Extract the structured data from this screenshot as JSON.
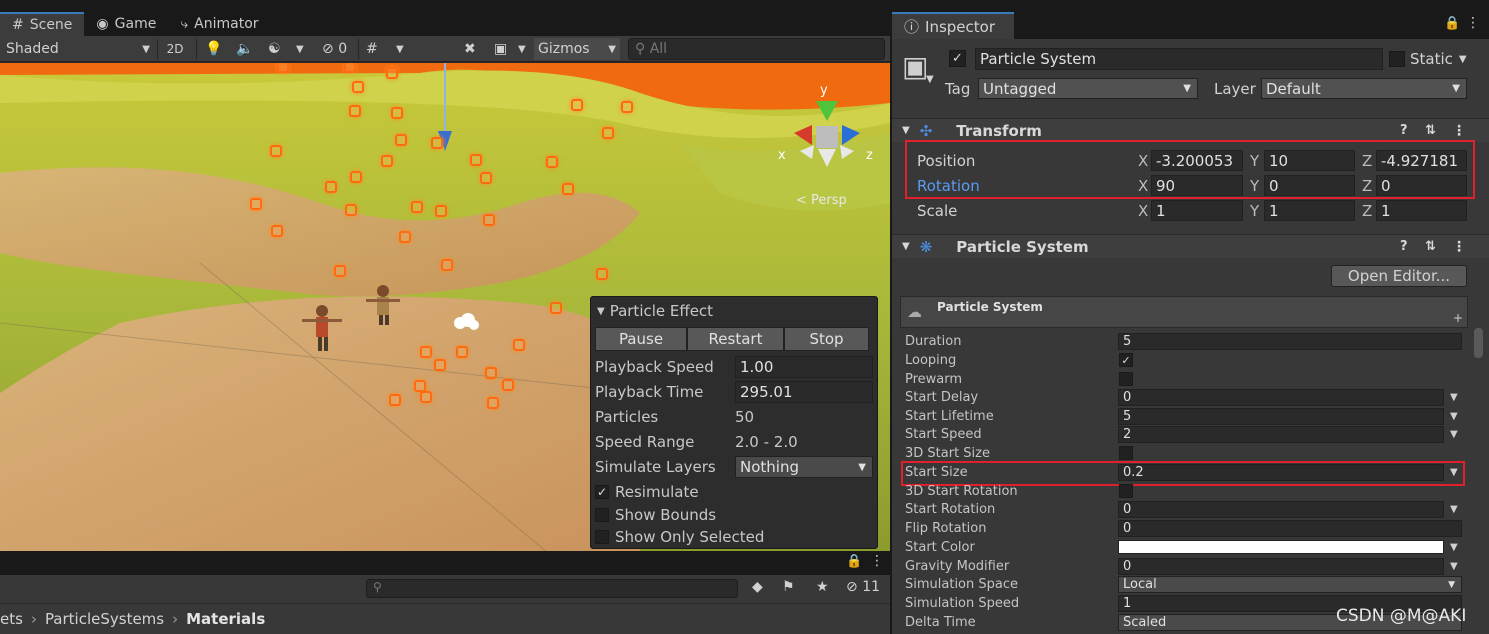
{
  "scene_tabs": [
    {
      "label": "Scene",
      "icon": "grid-icon"
    },
    {
      "label": "Game",
      "icon": "gamepad-icon"
    },
    {
      "label": "Animator",
      "icon": "animator-icon"
    }
  ],
  "scene_toolbar": {
    "shading_mode": "Shaded",
    "mode_2d": "2D",
    "hidden_count": "0",
    "gizmos": "Gizmos",
    "search_placeholder": "All"
  },
  "gizmo": {
    "y": "y",
    "x": "x",
    "z": "z",
    "persp": "< Persp"
  },
  "particle_effect": {
    "title": "Particle Effect",
    "pause": "Pause",
    "restart": "Restart",
    "stop": "Stop",
    "playback_speed_label": "Playback Speed",
    "playback_speed": "1.00",
    "playback_time_label": "Playback Time",
    "playback_time": "295.01",
    "particles_label": "Particles",
    "particles": "50",
    "speed_range_label": "Speed Range",
    "speed_range": "2.0 - 2.0",
    "simulate_layers_label": "Simulate Layers",
    "simulate_layers": "Nothing",
    "resimulate": "Resimulate",
    "show_bounds": "Show Bounds",
    "show_only_selected": "Show Only Selected"
  },
  "project": {
    "breadcrumb": [
      "ets",
      "ParticleSystems",
      "Materials"
    ],
    "hidden_count": "11"
  },
  "inspector": {
    "tab": "Inspector",
    "object_name": "Particle System",
    "static_label": "Static",
    "tag_label": "Tag",
    "tag_value": "Untagged",
    "layer_label": "Layer",
    "layer_value": "Default",
    "transform": {
      "title": "Transform",
      "position_label": "Position",
      "rotation_label": "Rotation",
      "scale_label": "Scale",
      "position": {
        "x": "-3.200053",
        "y": "10",
        "z": "-4.927181"
      },
      "rotation": {
        "x": "90",
        "y": "0",
        "z": "0"
      },
      "scale": {
        "x": "1",
        "y": "1",
        "z": "1"
      }
    },
    "particle_component_title": "Particle System",
    "open_editor": "Open Editor...",
    "module_title": "Particle System",
    "props": {
      "duration": {
        "label": "Duration",
        "value": "5"
      },
      "looping": {
        "label": "Looping"
      },
      "prewarm": {
        "label": "Prewarm"
      },
      "start_delay": {
        "label": "Start Delay",
        "value": "0"
      },
      "start_lifetime": {
        "label": "Start Lifetime",
        "value": "5"
      },
      "start_speed": {
        "label": "Start Speed",
        "value": "2"
      },
      "start_size_3d": {
        "label": "3D Start Size"
      },
      "start_size": {
        "label": "Start Size",
        "value": "0.2"
      },
      "start_rotation_3d": {
        "label": "3D Start Rotation"
      },
      "start_rotation": {
        "label": "Start Rotation",
        "value": "0"
      },
      "flip_rotation": {
        "label": "Flip Rotation",
        "value": "0"
      },
      "start_color": {
        "label": "Start Color"
      },
      "gravity_modifier": {
        "label": "Gravity Modifier",
        "value": "0"
      },
      "simulation_space": {
        "label": "Simulation Space",
        "value": "Local"
      },
      "simulation_speed": {
        "label": "Simulation Speed",
        "value": "1"
      },
      "delta_time": {
        "label": "Delta Time",
        "value": "Scaled"
      }
    }
  },
  "watermark": "CSDN @M@AKI",
  "colors": {
    "highlight_box": "#e0202c",
    "particle": "#ff6a10",
    "accent_blue": "#4c8fe0"
  }
}
